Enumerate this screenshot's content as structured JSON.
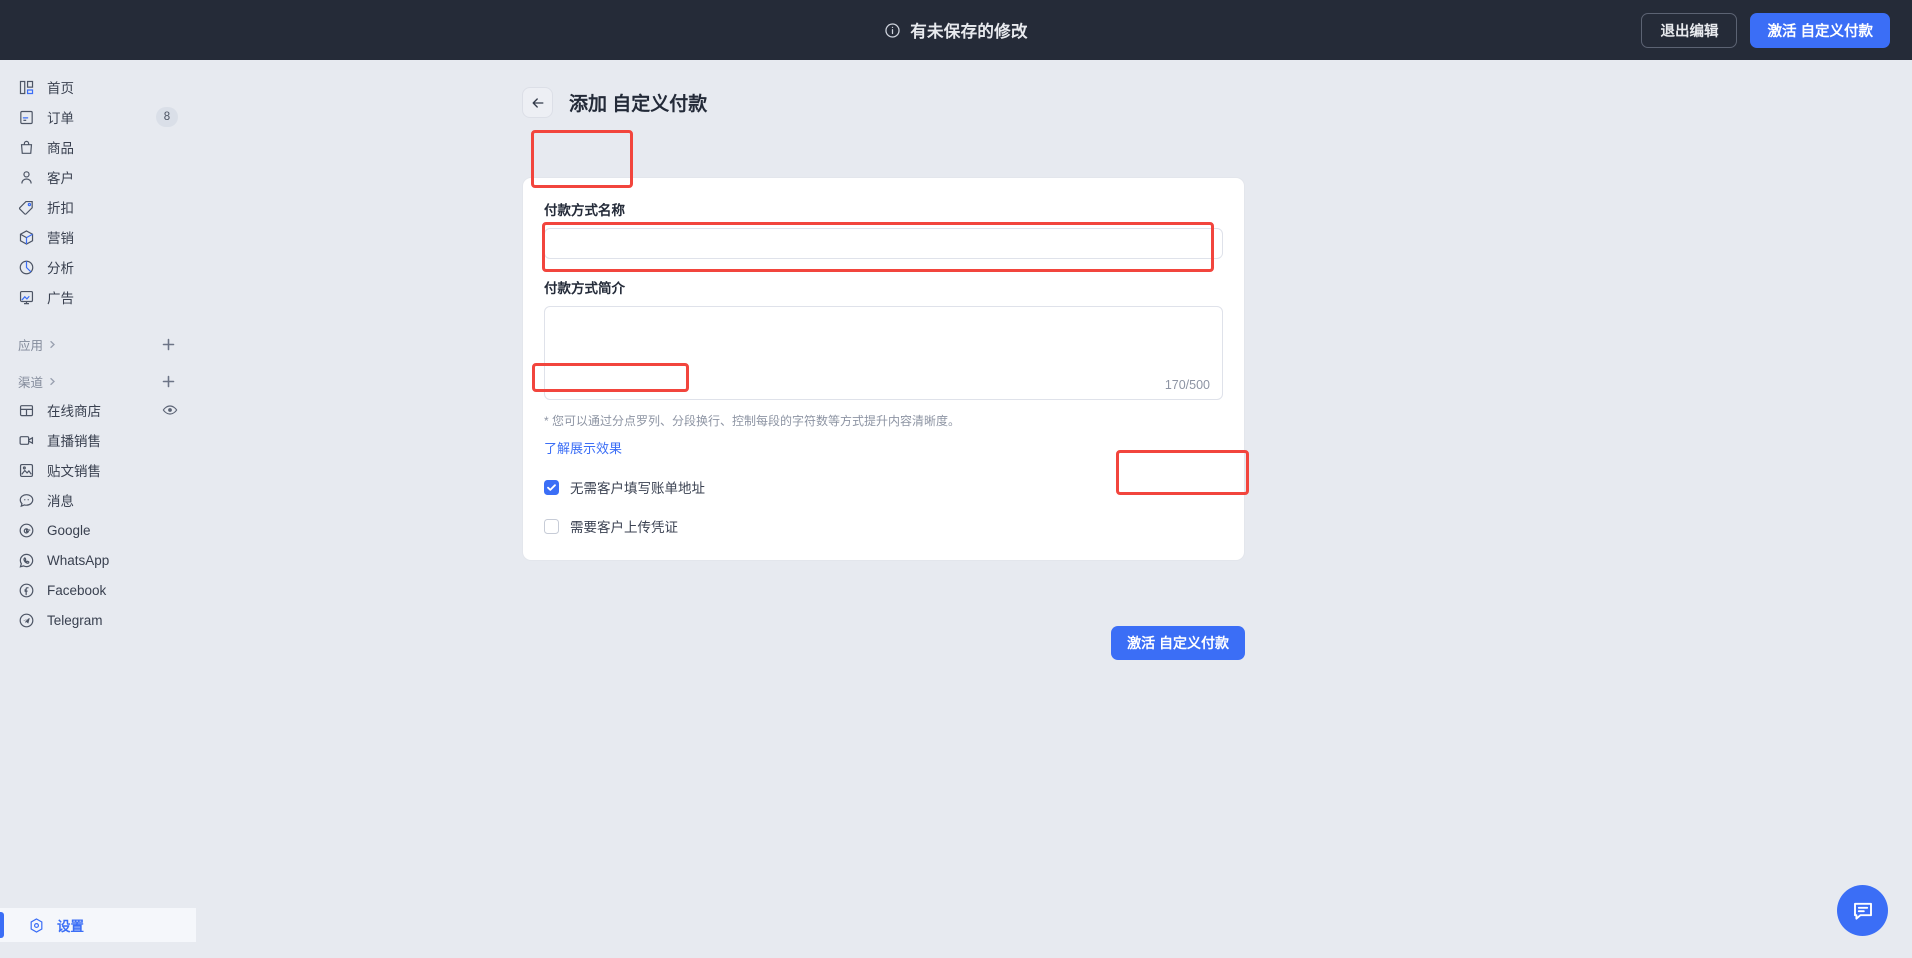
{
  "topbar": {
    "status_text": "有未保存的修改",
    "info_icon": "info-circle-icon",
    "exit_edit_label": "退出编辑",
    "activate_label": "激活 自定义付款"
  },
  "sidebar": {
    "items": [
      {
        "label": "首页",
        "icon": "home-dashboard-icon",
        "badge": ""
      },
      {
        "label": "订单",
        "icon": "orders-receipt-icon",
        "badge": "8"
      },
      {
        "label": "商品",
        "icon": "product-bag-icon",
        "badge": ""
      },
      {
        "label": "客户",
        "icon": "customer-person-icon",
        "badge": ""
      },
      {
        "label": "折扣",
        "icon": "discount-tag-icon",
        "badge": ""
      },
      {
        "label": "营销",
        "icon": "marketing-cube-icon",
        "badge": ""
      },
      {
        "label": "分析",
        "icon": "analytics-pie-icon",
        "badge": ""
      },
      {
        "label": "广告",
        "icon": "ads-image-chart-icon",
        "badge": ""
      }
    ],
    "sections": [
      {
        "label": "应用",
        "chevron_icon": "chevron-right-icon",
        "add_icon": "plus-icon"
      },
      {
        "label": "渠道",
        "chevron_icon": "chevron-right-icon",
        "add_icon": "plus-icon"
      }
    ],
    "channels": [
      {
        "label": "在线商店",
        "icon": "storefront-icon",
        "trailing_icon": "eye-icon"
      },
      {
        "label": "直播销售",
        "icon": "video-camera-icon",
        "trailing_icon": ""
      },
      {
        "label": "贴文销售",
        "icon": "image-post-icon",
        "trailing_icon": ""
      },
      {
        "label": "消息",
        "icon": "chat-bubble-icon",
        "trailing_icon": ""
      },
      {
        "label": "Google",
        "icon": "google-icon",
        "trailing_icon": ""
      },
      {
        "label": "WhatsApp",
        "icon": "whatsapp-icon",
        "trailing_icon": ""
      },
      {
        "label": "Facebook",
        "icon": "facebook-icon",
        "trailing_icon": ""
      },
      {
        "label": "Telegram",
        "icon": "telegram-icon",
        "trailing_icon": ""
      }
    ],
    "settings": {
      "label": "设置",
      "icon": "gear-hex-icon"
    }
  },
  "page": {
    "back_icon": "arrow-left-icon",
    "title": "添加 自定义付款"
  },
  "form": {
    "name_label": "付款方式名称",
    "name_value": "",
    "name_placeholder": "",
    "desc_label": "付款方式简介",
    "desc_value": "",
    "desc_placeholder": "",
    "char_counter": "170/500",
    "hint": "* 您可以通过分点罗列、分段换行、控制每段的字符数等方式提升内容清晰度。",
    "hint_link": "了解展示效果",
    "checkbox_no_billing": {
      "label": "无需客户填写账单地址",
      "checked": true
    },
    "checkbox_upload_proof": {
      "label": "需要客户上传凭证",
      "checked": false
    },
    "submit_label": "激活 自定义付款"
  },
  "fab": {
    "icon": "chat-message-icon"
  },
  "colors": {
    "accent": "#3b6ef6",
    "topbar_bg": "#252b38",
    "page_bg": "#e7eaf0",
    "annotation": "#f2453d"
  }
}
